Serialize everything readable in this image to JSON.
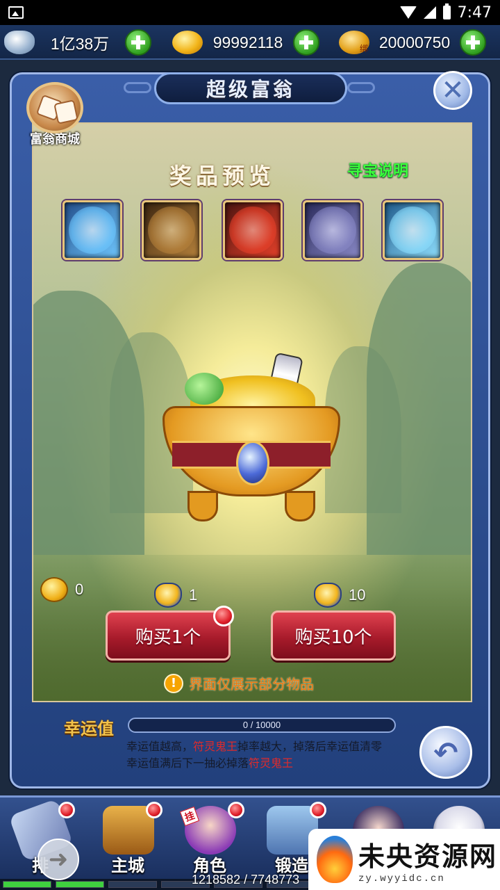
{
  "status_bar": {
    "time": "7:47"
  },
  "currency_bar": {
    "silver": "1亿38万",
    "gold": "99992118",
    "bound_gold": "20000750",
    "bound_gold_mark": "绑"
  },
  "panel": {
    "title": "超级富翁",
    "close_icon": "✕",
    "shop_label": "富翁商城"
  },
  "preview": {
    "title": "奖品预览",
    "rules_link": "寻宝说明",
    "prizes": [
      {
        "name": "ice-dragon",
        "color": "#6fc8ff"
      },
      {
        "name": "earth-dragon",
        "color": "#b8833c"
      },
      {
        "name": "fire-beast",
        "color": "#e8412a"
      },
      {
        "name": "thunder-beast",
        "color": "#8a8ac8"
      },
      {
        "name": "frost-spirit",
        "color": "#8fe0ff"
      }
    ]
  },
  "counts": {
    "coin": "0",
    "lamp_1": "1",
    "lamp_10": "10"
  },
  "buttons": {
    "buy_1": "购买1个",
    "buy_10": "购买10个"
  },
  "notice": {
    "icon": "!",
    "text": "界面仅展示部分物品"
  },
  "luck": {
    "label": "幸运值",
    "progress_text": "0 / 10000",
    "progress_fraction": 0,
    "line1_a": "幸运值越高，",
    "line1_red": "符灵鬼王",
    "line1_b": "掉率越大，掉落后幸运值清零",
    "line2_a": "幸运值满后下一抽必掉落",
    "line2_red": "符灵鬼王",
    "back_icon": "↶"
  },
  "nav": {
    "items": [
      {
        "label": "排",
        "icon": "sword-icon",
        "dot": true
      },
      {
        "label": "主城",
        "icon": "castle-icon",
        "dot": true
      },
      {
        "label": "角色",
        "icon": "hero-icon",
        "dot": true,
        "badge": "挂"
      },
      {
        "label": "锻造",
        "icon": "anvil-icon",
        "dot": true
      },
      {
        "label": "",
        "icon": "girl-icon",
        "dot": false
      },
      {
        "label": "",
        "icon": "panda-icon",
        "dot": false
      }
    ],
    "expand_icon": "➜",
    "exp_text": "1218582 / 7748773"
  },
  "watermark": {
    "main": "未央资源网",
    "sub": "zy.wyyidc.cn"
  }
}
